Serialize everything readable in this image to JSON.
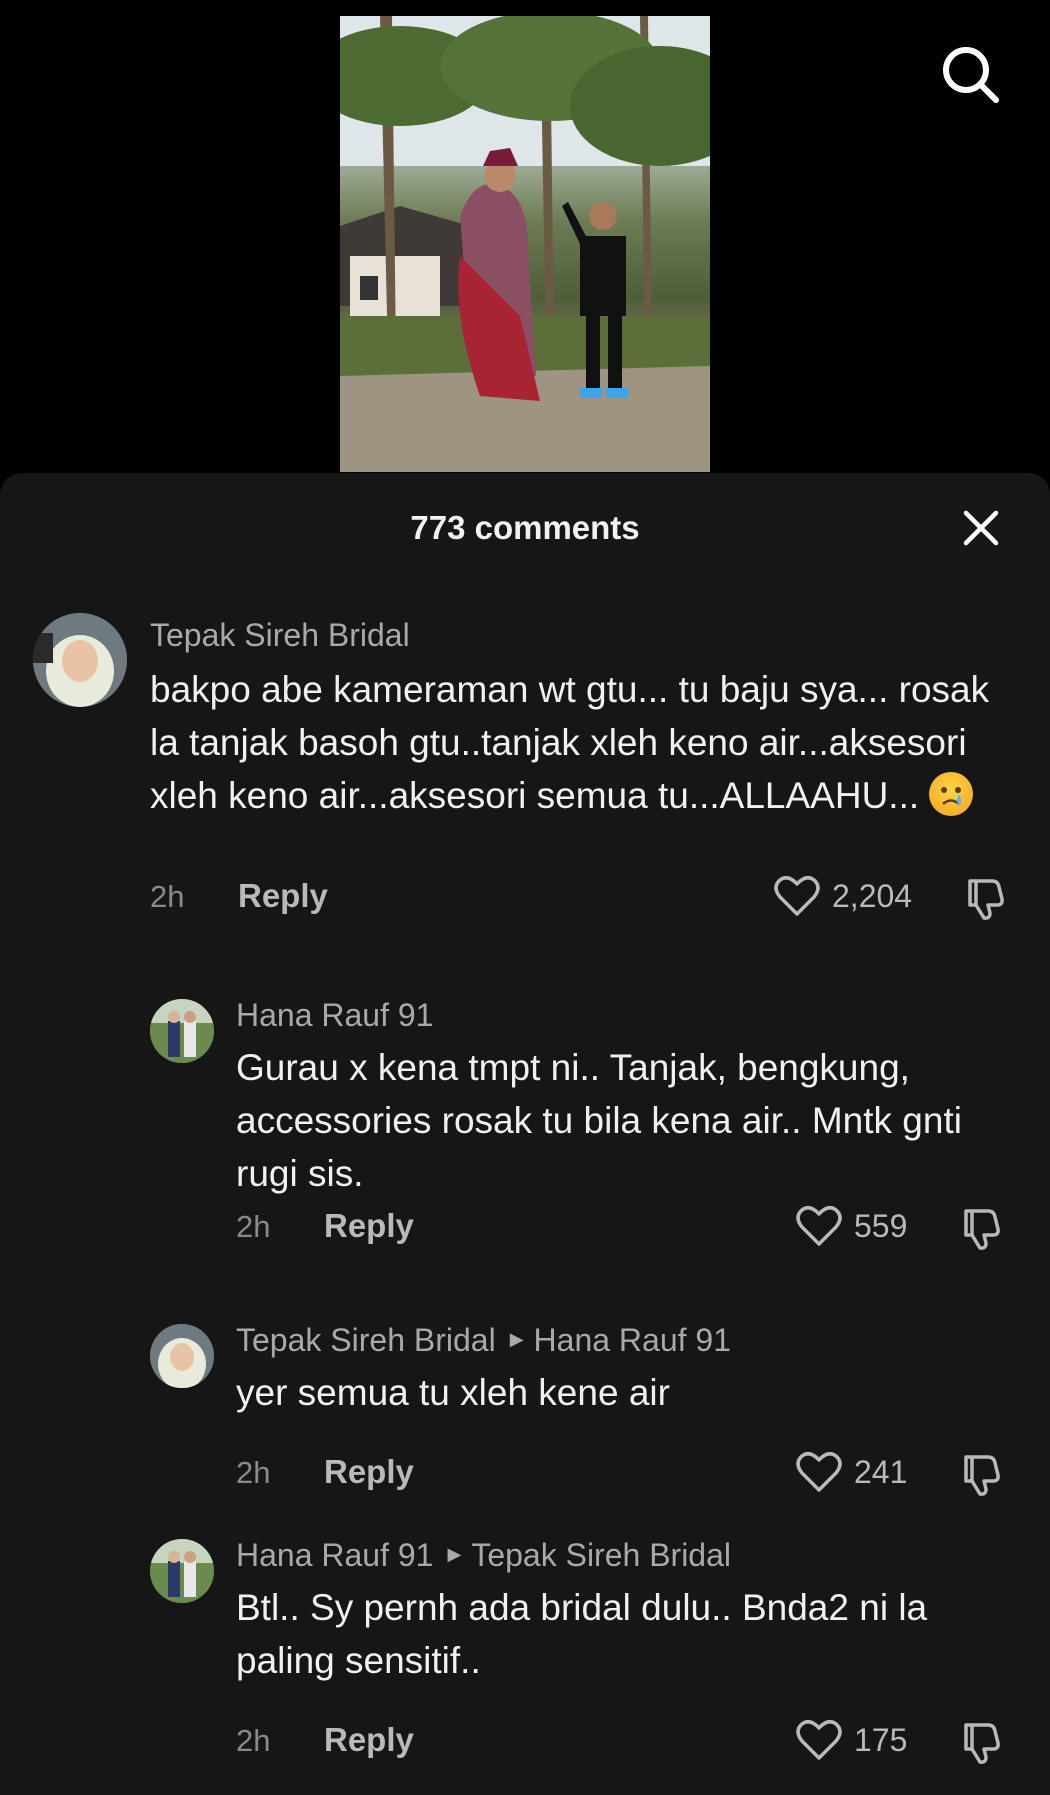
{
  "header": {
    "comments_count": "773 comments"
  },
  "comments": [
    {
      "author": "Tepak Sireh Bridal",
      "text": "bakpo abe kameraman wt gtu... tu baju sya... rosak la tanjak basoh gtu..tanjak xleh keno air...aksesori xleh keno air...aksesori semua tu...ALLAAHU...",
      "emoji": "crying-face",
      "time": "2h",
      "reply_label": "Reply",
      "likes": "2,204"
    },
    {
      "author": "Hana Rauf 91",
      "text": "Gurau x kena tmpt ni.. Tanjak, bengkung, accessories rosak tu bila kena air.. Mntk gnti rugi sis.",
      "time": "2h",
      "reply_label": "Reply",
      "likes": "559"
    },
    {
      "author": "Tepak Sireh Bridal",
      "reply_to": "Hana Rauf 91",
      "text": "yer semua tu xleh kene air",
      "time": "2h",
      "reply_label": "Reply",
      "likes": "241"
    },
    {
      "author": "Hana Rauf 91",
      "reply_to": "Tepak Sireh Bridal",
      "text": "Btl.. Sy pernh ada bridal dulu.. Bnda2 ni la paling sensitif..",
      "time": "2h",
      "reply_label": "Reply",
      "likes": "175"
    }
  ],
  "icons": {
    "search": "search-icon",
    "close": "close-icon",
    "like": "heart-icon",
    "dislike": "thumbs-down-icon"
  }
}
